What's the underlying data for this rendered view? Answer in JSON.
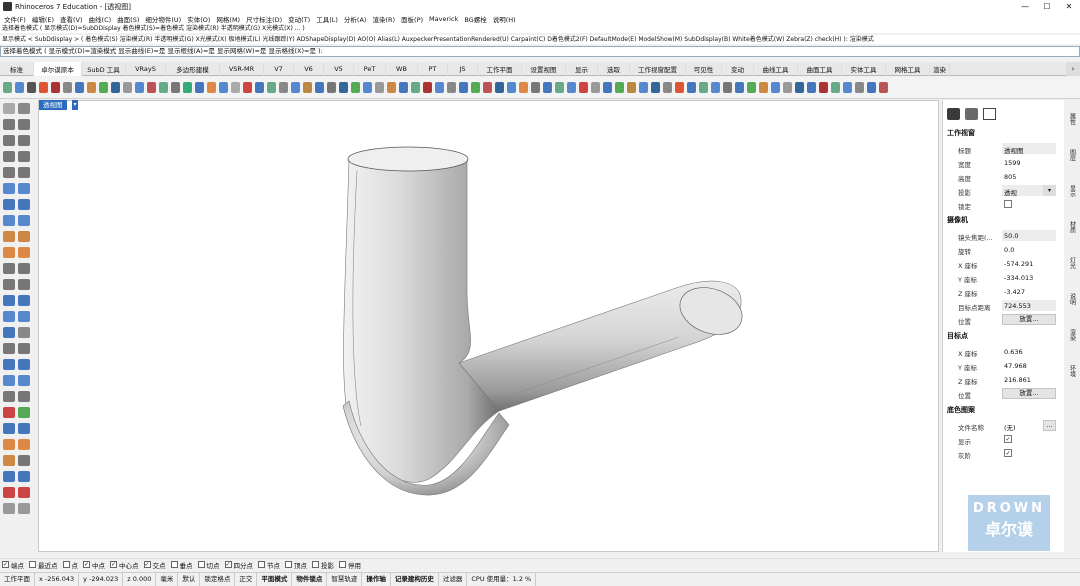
{
  "app": {
    "title": "Rhinoceros 7 Education - [透视图]",
    "window_controls": [
      "—",
      "☐",
      "✕"
    ]
  },
  "menu": [
    "文件(F)",
    "编辑(E)",
    "查看(V)",
    "曲线(C)",
    "曲面(S)",
    "细分物件(U)",
    "实体(O)",
    "网格(M)",
    "尺寸标注(D)",
    "变动(T)",
    "工具(L)",
    "分析(A)",
    "渲染(R)",
    "面板(P)",
    "Maverick",
    "BG螺栓",
    "说明(H)"
  ],
  "command_history": [
    "选择着色模式 ( 显示模式(D)=SubDDisplay  着色模式(S)=着色模式  渲染模式(R)  半透明模式(G)  X光模式(X) ... )",
    "显示模式 < SubDdisplay > ( 着色模式(S) 渲染模式(R) 半透明模式(G) X光模式(X) 极地模式(L) 光线跟踪(Y) ADShapeDisplay(D) AO(O) Alias(L) AuxpeckerPresentationRendered(U) Carpaint(C) D着色模式2(F) DefaultMode(E) ModelShow(M) SubDdisplay(B) White着色模式(W) Zebra(Z) check(H) ): 渲染模式",
    "选择着色模式 ( 显示模式(D)=渲染模式  显示曲线(E)=是  显示框线(A)=是  显示网格(W)=是  显示格线(X)=是 ):"
  ],
  "command_prompt": "选择着色模式 ( 显示模式(D)=渲染模式  显示曲线(E)=是  显示框线(A)=是  显示网格(W)=是  显示格线(X)=是 ):",
  "tabs": [
    "标准",
    "卓尔谟原本",
    "SubD 工具",
    "VRayS",
    "多边形建模",
    "VSR-MR",
    "V7",
    "V6",
    "V5",
    "PeT",
    "WB",
    "PT",
    "JS",
    "工作平面",
    "设置视图",
    "显示",
    "选取",
    "工作视窗配置",
    "可见性",
    "变动",
    "曲线工具",
    "曲面工具",
    "实体工具",
    "网格工具",
    "渲染"
  ],
  "viewport": {
    "label": "透视图",
    "arrow": "▾"
  },
  "panel_icons": [
    "viewport-props-icon",
    "gear-icon",
    "frame-icon"
  ],
  "panel": {
    "sec_viewport": "工作视窗",
    "viewport_rows": [
      {
        "label": "标题",
        "value": "透视图"
      },
      {
        "label": "宽度",
        "value": "1599"
      },
      {
        "label": "高度",
        "value": "805"
      },
      {
        "label": "投影",
        "value": "透视"
      },
      {
        "label": "锁定",
        "value": ""
      }
    ],
    "sec_camera": "摄像机",
    "camera_rows": [
      {
        "label": "镜头焦距(...",
        "value": "50.0"
      },
      {
        "label": "旋转",
        "value": "0.0"
      },
      {
        "label": "X 座标",
        "value": "-574.291"
      },
      {
        "label": "Y 座标",
        "value": "-334.013"
      },
      {
        "label": "Z 座标",
        "value": "-3.427"
      },
      {
        "label": "目标点距离",
        "value": "724.553"
      },
      {
        "label": "位置",
        "value": "放置..."
      }
    ],
    "sec_target": "目标点",
    "target_rows": [
      {
        "label": "X 座标",
        "value": "0.636"
      },
      {
        "label": "Y 座标",
        "value": "47.968"
      },
      {
        "label": "Z 座标",
        "value": "216.861"
      },
      {
        "label": "位置",
        "value": "放置..."
      }
    ],
    "sec_wallpaper": "底色图案",
    "wallpaper_rows": [
      {
        "label": "文件名称",
        "value": "(无)"
      },
      {
        "label": "显示",
        "value": "✓"
      },
      {
        "label": "灰阶",
        "value": "✓"
      }
    ]
  },
  "right_tabs": [
    "属性",
    "图层",
    "显示",
    "材质",
    "灯光",
    "说明",
    "渲染",
    "环境"
  ],
  "osnaps": [
    {
      "label": "端点",
      "checked": true
    },
    {
      "label": "最近点",
      "checked": false
    },
    {
      "label": "点",
      "checked": false
    },
    {
      "label": "中点",
      "checked": true
    },
    {
      "label": "中心点",
      "checked": true
    },
    {
      "label": "交点",
      "checked": true
    },
    {
      "label": "垂点",
      "checked": false
    },
    {
      "label": "切点",
      "checked": false
    },
    {
      "label": "四分点",
      "checked": true
    },
    {
      "label": "节点",
      "checked": false
    },
    {
      "label": "顶点",
      "checked": false
    },
    {
      "label": "投影",
      "checked": false
    },
    {
      "label": "停用",
      "checked": false
    }
  ],
  "status": {
    "cplane": "工作平面",
    "x": "x -256.043",
    "y": "y -294.023",
    "z": "z 0.000",
    "units": "毫米",
    "layer": "默认",
    "items": [
      "锁定格点",
      "正交",
      "平面模式",
      "物件锁点",
      "智慧轨迹",
      "操作轴",
      "记录建构历史",
      "过滤器",
      "CPU 使用量：1.2 %"
    ]
  },
  "watermark": {
    "line1": "DROWN",
    "line2": "卓尔谟"
  },
  "colors": {
    "accent": "#2b6cc0",
    "viewport_bg": "#ffffff",
    "model": "#d9d9d9"
  }
}
